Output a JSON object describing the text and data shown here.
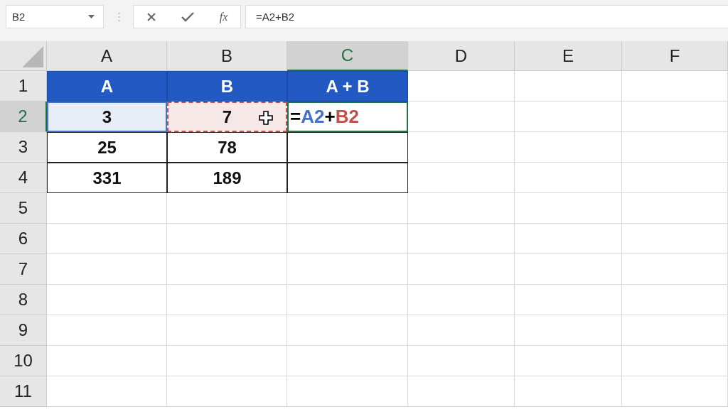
{
  "formula_bar": {
    "name_box": "B2",
    "function_button": "fx",
    "formula": "=A2+B2"
  },
  "columns": [
    {
      "label": "A",
      "selected": false
    },
    {
      "label": "B",
      "selected": false
    },
    {
      "label": "C",
      "selected": true
    },
    {
      "label": "D",
      "selected": false
    },
    {
      "label": "E",
      "selected": false
    },
    {
      "label": "F",
      "selected": false
    }
  ],
  "rows": [
    {
      "label": "1",
      "selected": false,
      "cells": [
        {
          "kind": "header",
          "text": "A"
        },
        {
          "kind": "header",
          "text": "B"
        },
        {
          "kind": "header",
          "text": "A + B"
        }
      ]
    },
    {
      "label": "2",
      "selected": true,
      "cells": [
        {
          "kind": "value",
          "text": "3",
          "color": "#4472c4"
        },
        {
          "kind": "value",
          "text": "7",
          "color": "#c0504d",
          "marquee": true
        },
        {
          "kind": "formula",
          "editing": true,
          "parts": [
            {
              "text": "=",
              "color": "#000000"
            },
            {
              "text": "A2",
              "color": "#4472c4"
            },
            {
              "text": "+",
              "color": "#000000"
            },
            {
              "text": "B2",
              "color": "#c0504d"
            }
          ]
        }
      ]
    },
    {
      "label": "3",
      "selected": false,
      "cells": [
        {
          "kind": "value",
          "text": "25"
        },
        {
          "kind": "value",
          "text": "78"
        },
        {
          "kind": "empty"
        }
      ]
    },
    {
      "label": "4",
      "selected": false,
      "cells": [
        {
          "kind": "value",
          "text": "331"
        },
        {
          "kind": "value",
          "text": "189"
        },
        {
          "kind": "empty"
        }
      ]
    },
    {
      "label": "5",
      "selected": false,
      "cells": []
    },
    {
      "label": "6",
      "selected": false,
      "cells": []
    },
    {
      "label": "7",
      "selected": false,
      "cells": []
    },
    {
      "label": "8",
      "selected": false,
      "cells": []
    },
    {
      "label": "9",
      "selected": false,
      "cells": []
    },
    {
      "label": "10",
      "selected": false,
      "cells": []
    },
    {
      "label": "11",
      "selected": false,
      "cells": []
    }
  ]
}
